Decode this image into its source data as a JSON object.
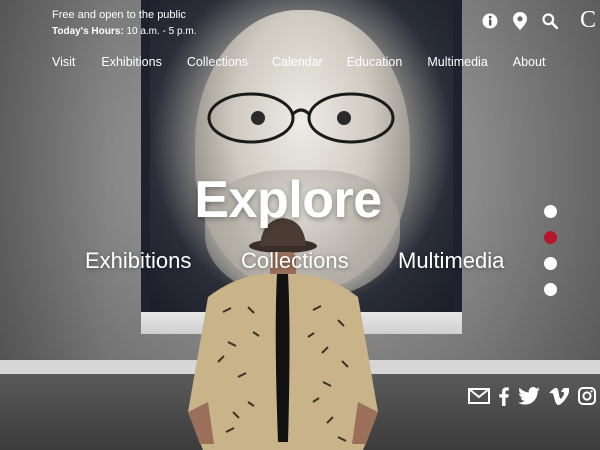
{
  "header": {
    "notice_line1": "Free and open to the public",
    "hours_label": "Today's Hours:",
    "hours_value": "10 a.m. - 5 p.m.",
    "logo_fragment": "C",
    "icons": [
      "info-icon",
      "location-pin-icon",
      "search-icon"
    ]
  },
  "nav": {
    "items": [
      "Visit",
      "Exhibitions",
      "Collections",
      "Calendar",
      "Education",
      "Multimedia",
      "About"
    ]
  },
  "hero": {
    "title": "Explore",
    "links": [
      "Exhibitions",
      "Collections",
      "Multimedia"
    ],
    "slide_count": 4,
    "active_slide": 2
  },
  "social": {
    "icons": [
      "email-icon",
      "facebook-icon",
      "twitter-icon",
      "vimeo-icon",
      "instagram-icon"
    ]
  },
  "colors": {
    "accent": "#b5162b",
    "text": "#ffffff"
  }
}
